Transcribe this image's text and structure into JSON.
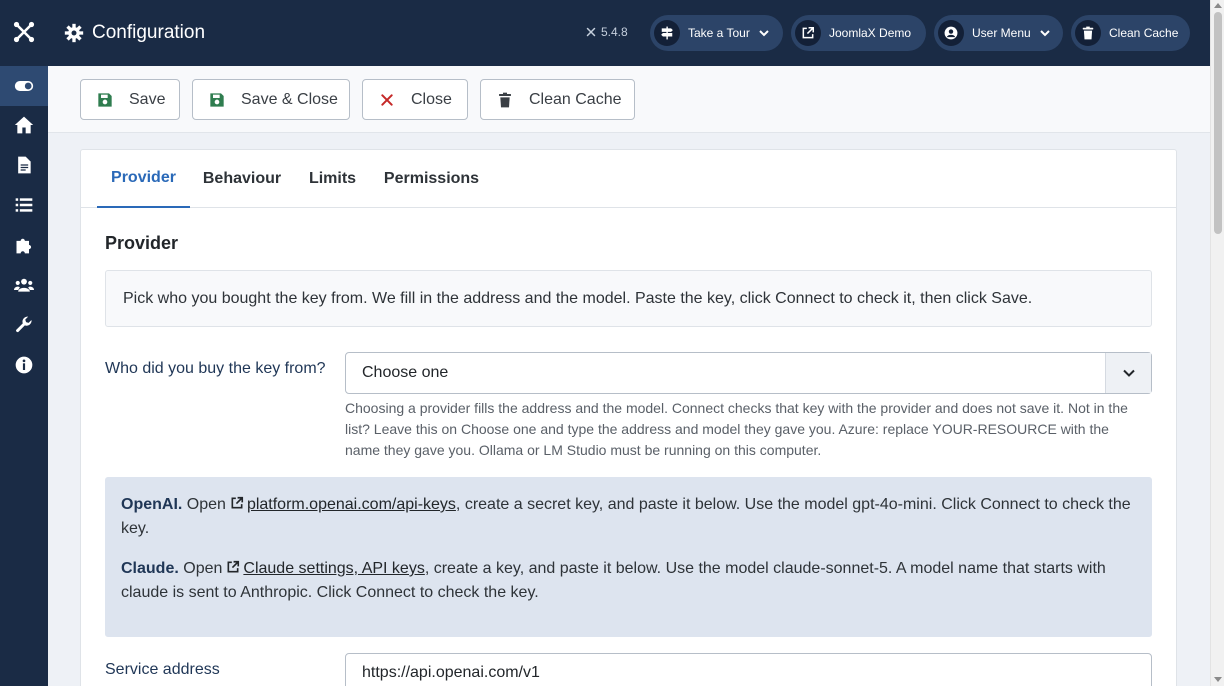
{
  "app": {
    "title": "Configuration",
    "version": "5.4.8"
  },
  "sidebar": {
    "logo": "joomla-logo-icon",
    "items": [
      {
        "icon": "toggle-icon",
        "active": true
      },
      {
        "icon": "home-icon"
      },
      {
        "icon": "article-icon"
      },
      {
        "icon": "list-icon"
      },
      {
        "icon": "puzzle-icon"
      },
      {
        "icon": "users-icon"
      },
      {
        "icon": "wrench-icon"
      },
      {
        "icon": "info-icon"
      }
    ]
  },
  "header": {
    "buttons": [
      {
        "label": "Take a Tour",
        "icon": "signpost-icon",
        "dropdown": true
      },
      {
        "label": "JoomlaX Demo",
        "icon": "external-link-icon"
      },
      {
        "label": "User Menu",
        "icon": "user-icon",
        "dropdown": true
      },
      {
        "label": "Clean Cache",
        "icon": "trash-icon"
      }
    ]
  },
  "toolbar": {
    "save": "Save",
    "save_close": "Save & Close",
    "close": "Close",
    "clean_cache": "Clean Cache"
  },
  "tabs": [
    "Provider",
    "Behaviour",
    "Limits",
    "Permissions"
  ],
  "active_tab": "Provider",
  "provider": {
    "section_title": "Provider",
    "intro": "Pick who you bought the key from. We fill in the address and the model. Paste the key, click Connect to check it, then click Save.",
    "who_label": "Who did you buy the key from?",
    "who_value": "Choose one",
    "who_help": "Choosing a provider fills the address and the model. Connect checks that key with the provider and does not save it. Not in the list? Leave this on Choose one and type the address and model they gave you. Azure: replace YOUR-RESOURCE with the name they gave you. Ollama or LM Studio must be running on this computer.",
    "openai": {
      "name": "OpenAI.",
      "pre": "Open",
      "link": "platform.openai.com/api-keys",
      "post": ", create a secret key, and paste it below. Use the model gpt-4o-mini. Click Connect to check the key."
    },
    "claude": {
      "name": "Claude.",
      "pre": "Open",
      "link": "Claude settings, API keys",
      "post": ", create a key, and paste it below. Use the model claude-sonnet-5. A model name that starts with claude is sent to Anthropic. Click Connect to check the key."
    },
    "service_label": "Service address",
    "service_value": "https://api.openai.com/v1"
  },
  "colors": {
    "sidebar_bg": "#1a2b45",
    "accent": "#2a69b8",
    "save_green": "#2f7d4f",
    "close_red": "#c52827",
    "info_bg": "#dde4ef"
  }
}
